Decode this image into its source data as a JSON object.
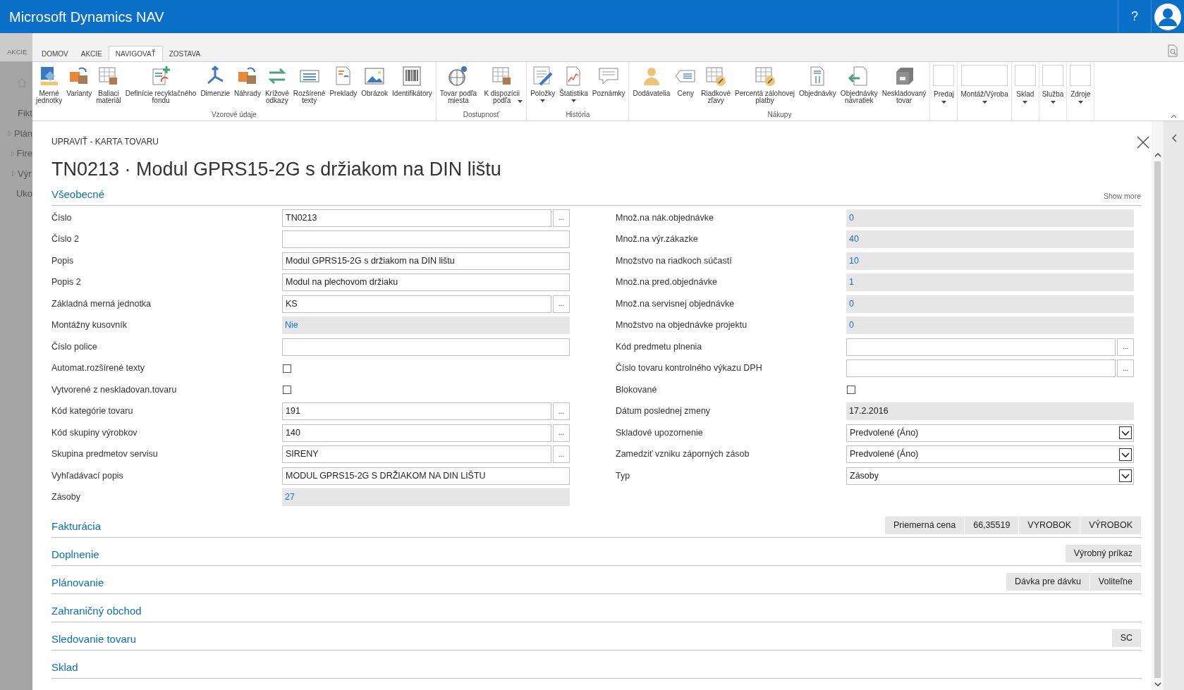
{
  "header": {
    "title": "Microsoft Dynamics NAV",
    "help": "?"
  },
  "background": {
    "tab": "AKCIE",
    "items": [
      {
        "label": "Fikt",
        "expandable": false
      },
      {
        "label": "Plán",
        "expandable": true
      },
      {
        "label": "Fire",
        "expandable": true
      },
      {
        "label": "Výr",
        "expandable": true
      },
      {
        "label": "Uko",
        "expandable": false
      }
    ]
  },
  "tabs": [
    {
      "label": "DOMOV",
      "selected": false
    },
    {
      "label": "AKCIE",
      "selected": false
    },
    {
      "label": "NAVIGOVAŤ",
      "selected": true
    },
    {
      "label": "ZOSTAVA",
      "selected": false
    }
  ],
  "ribbon": {
    "groups": [
      {
        "label": "Vzorové údaje",
        "items": [
          {
            "label": "Merné\njednotky",
            "dropdown": false
          },
          {
            "label": "Varianty",
            "dropdown": false
          },
          {
            "label": "Baliaci\nmateriál",
            "dropdown": false
          },
          {
            "label": "Definície recyklačného\nfondu",
            "dropdown": false
          },
          {
            "label": "Dimenzie",
            "dropdown": false
          },
          {
            "label": "Náhrady",
            "dropdown": false
          },
          {
            "label": "Krížové\nodkazy",
            "dropdown": false
          },
          {
            "label": "Rozšírené\ntexty",
            "dropdown": false
          },
          {
            "label": "Preklady",
            "dropdown": false
          },
          {
            "label": "Obrázok",
            "dropdown": false
          },
          {
            "label": "Identifikátory",
            "dropdown": false
          }
        ]
      },
      {
        "label": "Dostupnosť",
        "items": [
          {
            "label": "Tovar podľa\nmiesta",
            "dropdown": false
          },
          {
            "label": "K dispozícii\npodľa",
            "dropdown": true
          }
        ]
      },
      {
        "label": "História",
        "items": [
          {
            "label": "Položky",
            "dropdown": true
          },
          {
            "label": "Štatistika",
            "dropdown": true
          },
          {
            "label": "Poznámky",
            "dropdown": false
          }
        ]
      },
      {
        "label": "Nákupy",
        "items": [
          {
            "label": "Dodávatelia",
            "dropdown": false
          },
          {
            "label": "Ceny",
            "dropdown": false
          },
          {
            "label": "Riadkové\nzľavy",
            "dropdown": false
          },
          {
            "label": "Percentá zálohovej\nplatby",
            "dropdown": false
          },
          {
            "label": "Objednávky",
            "dropdown": false
          },
          {
            "label": "Objednávky\nnávratiek",
            "dropdown": false
          },
          {
            "label": "Neskladovaný\ntovar",
            "dropdown": false
          }
        ]
      }
    ],
    "menus": [
      {
        "label": "Predaj",
        "dropdown": true
      },
      {
        "label": "Montáž/Výroba",
        "dropdown": true
      },
      {
        "label": "Sklad",
        "dropdown": true
      },
      {
        "label": "Služba",
        "dropdown": true
      },
      {
        "label": "Zdroje",
        "dropdown": true
      }
    ]
  },
  "dialog": {
    "breadcrumb": "UPRAVIŤ - KARTA TOVARU",
    "title": "TN0213 · Modul GPRS15-2G s držiakom na DIN lištu",
    "general": {
      "title": "Všeobecné",
      "show_more": "Show more",
      "left": [
        {
          "label": "Číslo",
          "kind": "lookup",
          "value": "TN0213",
          "button": "..."
        },
        {
          "label": "Číslo 2",
          "kind": "text"
        },
        {
          "label": "Popis",
          "kind": "text",
          "value": "Modul GPRS15-2G s držiakom na DIN lištu"
        },
        {
          "label": "Popis 2",
          "kind": "text",
          "value": "Modul na plechovom držiaku"
        },
        {
          "label": "Základná merná jednotka",
          "kind": "lookup",
          "value": "KS",
          "button": "..."
        },
        {
          "label": "Montážny kusovník",
          "kind": "flowfield",
          "value": "Nie"
        },
        {
          "label": "Číslo police",
          "kind": "text"
        },
        {
          "label": "Automat.rozšírené texty",
          "kind": "checkbox",
          "checked": false
        },
        {
          "label": "Vytvorené z neskladovan.tovaru",
          "kind": "checkbox",
          "checked": false
        },
        {
          "label": "Kód kategórie tovaru",
          "kind": "lookup",
          "value": "191",
          "button": "..."
        },
        {
          "label": "Kód skupiny výrobkov",
          "kind": "lookup",
          "value": "140",
          "button": "..."
        },
        {
          "label": "Skupina predmetov servisu",
          "kind": "lookup",
          "value": "SIRENY",
          "button": "..."
        },
        {
          "label": "Vyhľadávací popis",
          "kind": "text",
          "value": "MODUL GPRS15-2G S DRŽIAKOM NA DIN LIŠTU"
        },
        {
          "label": "Zásoby",
          "kind": "flowfield",
          "value": "27"
        }
      ],
      "right": [
        {
          "label": "Množ.na nák.objednávke",
          "kind": "flowfield",
          "value": "0"
        },
        {
          "label": "Množ.na výr.zákazke",
          "kind": "flowfield",
          "value": "40"
        },
        {
          "label": "Množstvo na riadkoch súčastí",
          "kind": "flowfield",
          "value": "10"
        },
        {
          "label": "Množ.na pred.objednávke",
          "kind": "flowfield",
          "value": "1"
        },
        {
          "label": "Množ.na servisnej objednávke",
          "kind": "flowfield",
          "value": "0"
        },
        {
          "label": "Množstvo na objednávke projektu",
          "kind": "flowfield",
          "value": "0"
        },
        {
          "label": "Kód predmetu plnenia",
          "kind": "lookup",
          "button": "..."
        },
        {
          "label": "Číslo tovaru kontrolného výkazu DPH",
          "kind": "lookup",
          "button": "..."
        },
        {
          "label": "Blokované",
          "kind": "checkbox",
          "checked": false
        },
        {
          "label": "Dátum poslednej zmeny",
          "kind": "readonly",
          "value": "17.2.2016"
        },
        {
          "label": "Skladové upozornenie",
          "kind": "select",
          "value": "Predvolené (Áno)"
        },
        {
          "label": "Zamedziť vzniku záporných zásob",
          "kind": "select",
          "value": "Predvolené (Áno)"
        },
        {
          "label": "Typ",
          "kind": "select",
          "value": "Zásoby"
        }
      ]
    },
    "sections": [
      {
        "title": "Fakturácia",
        "summary": [
          "Priemerná cena",
          "66,35519",
          "VYROBOK",
          "VÝROBOK"
        ]
      },
      {
        "title": "Doplnenie",
        "summary": [
          "Výrobný príkaz"
        ]
      },
      {
        "title": "Plánovanie",
        "summary": [
          "Dávka pre dávku",
          "Voliteľne"
        ]
      },
      {
        "title": "Zahraničný obchod"
      },
      {
        "title": "Sledovanie tovaru",
        "summary": [
          "SC"
        ]
      },
      {
        "title": "Sklad"
      }
    ]
  }
}
